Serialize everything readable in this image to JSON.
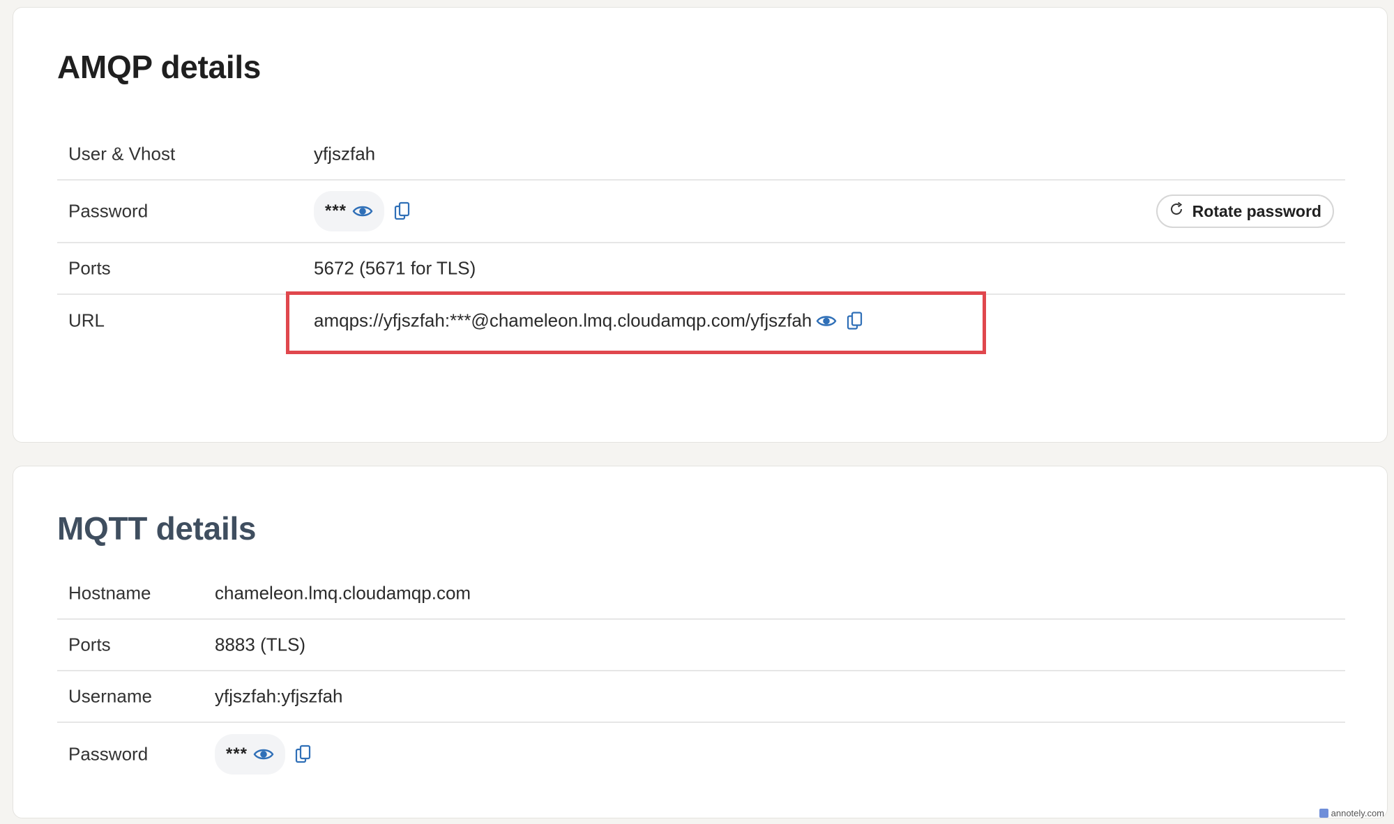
{
  "amqp": {
    "title": "AMQP details",
    "user_vhost": {
      "label": "User & Vhost",
      "value": "yfjszfah"
    },
    "password": {
      "label": "Password",
      "masked": "***",
      "rotate_label": "Rotate password"
    },
    "ports": {
      "label": "Ports",
      "value": "5672 (5671 for TLS)"
    },
    "url": {
      "label": "URL",
      "value": "amqps://yfjszfah:***@chameleon.lmq.cloudamqp.com/yfjszfah"
    }
  },
  "mqtt": {
    "title": "MQTT details",
    "hostname": {
      "label": "Hostname",
      "value": "chameleon.lmq.cloudamqp.com"
    },
    "ports": {
      "label": "Ports",
      "value": "8883 (TLS)"
    },
    "username": {
      "label": "Username",
      "value": "yfjszfah:yfjszfah"
    },
    "password": {
      "label": "Password",
      "masked": "***"
    }
  },
  "watermark": "annotely.com",
  "colors": {
    "icon_blue": "#2f6fb7",
    "highlight_red": "#e0474d",
    "mqtt_title": "#3f4e5f"
  },
  "icons": [
    "eye-icon",
    "copy-icon",
    "rotate-icon"
  ]
}
